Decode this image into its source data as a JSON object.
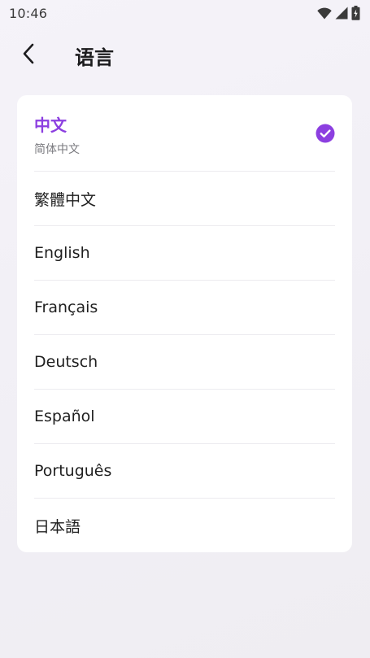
{
  "status_bar": {
    "time": "10:46",
    "icons": [
      "wifi-icon",
      "signal-icon",
      "battery-icon"
    ]
  },
  "header": {
    "back_icon": "chevron-left-icon",
    "title": "语言"
  },
  "languages": {
    "selected_index": 0,
    "items": [
      {
        "label": "中文",
        "sublabel": "简体中文",
        "selected": true
      },
      {
        "label": "繁體中文"
      },
      {
        "label": "English"
      },
      {
        "label": "Français"
      },
      {
        "label": "Deutsch"
      },
      {
        "label": "Español"
      },
      {
        "label": "Português"
      },
      {
        "label": "日本語"
      }
    ]
  },
  "colors": {
    "accent": "#8c3fe0",
    "background": "#f3f1f6",
    "card": "#ffffff",
    "text": "#1f1f1f",
    "subtext": "#7a7a7f"
  }
}
